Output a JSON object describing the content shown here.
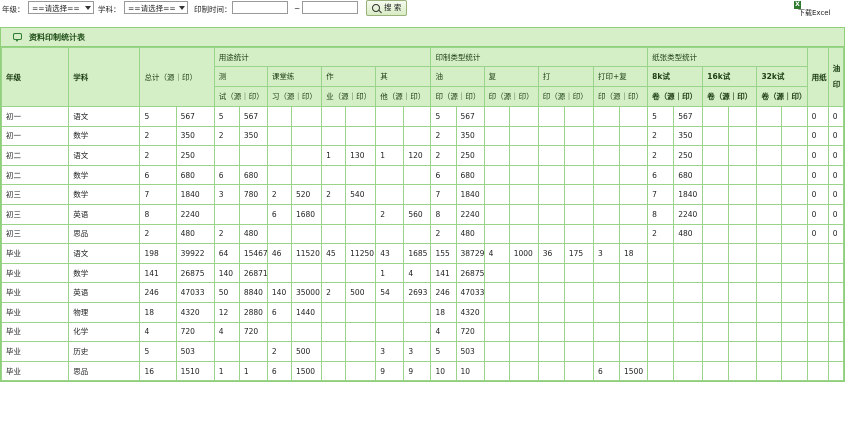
{
  "toolbar": {
    "grade_label": "年级：",
    "grade_value": "==请选择==",
    "subject_label": "学科：",
    "subject_value": "==请选择==",
    "time_label": "印制时间：",
    "time_sep": "~",
    "search_label": "搜 索",
    "excel_label": "下载Excel"
  },
  "panel": {
    "title": "资料印制统计表"
  },
  "table": {
    "h": {
      "grade": "年级",
      "subject": "学科",
      "total": "总计（源｜印）",
      "usage": "用途统计",
      "printtype": "印制类型统计",
      "paper": "纸张类型统计",
      "paperuse": "用纸",
      "oilprint": "油印",
      "test_a": "测",
      "test_b": "试（源｜印）",
      "class_a": "课堂练",
      "class_b": "习（源｜印）",
      "work_a": "作",
      "work_b": "业（源｜印）",
      "other_a": "其",
      "other_b": "他（源｜印）",
      "oil_a": "油",
      "oil_b": "印（源｜印）",
      "copy_a": "复",
      "copy_b": "印（源｜印）",
      "print_a": "打",
      "print_b": "印（源｜印）",
      "pc_a": "打印+复",
      "pc_b": "印（源｜印）",
      "p8k_a": "8k试",
      "p8k_b": "卷（源｜印）",
      "p16k_a": "16k试",
      "p16k_b": "卷（源｜印）",
      "p32k_a": "32k试",
      "p32k_b": "卷（源｜印）"
    },
    "rows": [
      [
        "初一",
        "语文",
        "5",
        "567",
        "5",
        "567",
        "",
        "",
        "",
        "",
        "",
        "",
        "5",
        "567",
        "",
        "",
        "",
        "",
        "",
        "",
        "5",
        "567",
        "",
        "",
        "",
        "",
        "0",
        "0"
      ],
      [
        "初一",
        "数学",
        "2",
        "350",
        "2",
        "350",
        "",
        "",
        "",
        "",
        "",
        "",
        "2",
        "350",
        "",
        "",
        "",
        "",
        "",
        "",
        "2",
        "350",
        "",
        "",
        "",
        "",
        "0",
        "0"
      ],
      [
        "初二",
        "语文",
        "2",
        "250",
        "",
        "",
        "",
        "",
        "1",
        "130",
        "1",
        "120",
        "2",
        "250",
        "",
        "",
        "",
        "",
        "",
        "",
        "2",
        "250",
        "",
        "",
        "",
        "",
        "0",
        "0"
      ],
      [
        "初二",
        "数学",
        "6",
        "680",
        "6",
        "680",
        "",
        "",
        "",
        "",
        "",
        "",
        "6",
        "680",
        "",
        "",
        "",
        "",
        "",
        "",
        "6",
        "680",
        "",
        "",
        "",
        "",
        "0",
        "0"
      ],
      [
        "初三",
        "数学",
        "7",
        "1840",
        "3",
        "780",
        "2",
        "520",
        "2",
        "540",
        "",
        "",
        "7",
        "1840",
        "",
        "",
        "",
        "",
        "",
        "",
        "7",
        "1840",
        "",
        "",
        "",
        "",
        "0",
        "0"
      ],
      [
        "初三",
        "英语",
        "8",
        "2240",
        "",
        "",
        "6",
        "1680",
        "",
        "",
        "2",
        "560",
        "8",
        "2240",
        "",
        "",
        "",
        "",
        "",
        "",
        "8",
        "2240",
        "",
        "",
        "",
        "",
        "0",
        "0"
      ],
      [
        "初三",
        "思品",
        "2",
        "480",
        "2",
        "480",
        "",
        "",
        "",
        "",
        "",
        "",
        "2",
        "480",
        "",
        "",
        "",
        "",
        "",
        "",
        "2",
        "480",
        "",
        "",
        "",
        "",
        "0",
        "0"
      ],
      [
        "毕业",
        "语文",
        "198",
        "39922",
        "64",
        "15467",
        "46",
        "11520",
        "45",
        "11250",
        "43",
        "1685",
        "155",
        "38729",
        "4",
        "1000",
        "36",
        "175",
        "3",
        "18",
        "",
        "",
        "",
        "",
        "",
        "",
        "",
        ""
      ],
      [
        "毕业",
        "数学",
        "141",
        "26875",
        "140",
        "26871",
        "",
        "",
        "",
        "",
        "1",
        "4",
        "141",
        "26875",
        "",
        "",
        "",
        "",
        "",
        "",
        "",
        "",
        "",
        "",
        "",
        "",
        "",
        ""
      ],
      [
        "毕业",
        "英语",
        "246",
        "47033",
        "50",
        "8840",
        "140",
        "35000",
        "2",
        "500",
        "54",
        "2693",
        "246",
        "47033",
        "",
        "",
        "",
        "",
        "",
        "",
        "",
        "",
        "",
        "",
        "",
        "",
        "",
        ""
      ],
      [
        "毕业",
        "物理",
        "18",
        "4320",
        "12",
        "2880",
        "6",
        "1440",
        "",
        "",
        "",
        "",
        "18",
        "4320",
        "",
        "",
        "",
        "",
        "",
        "",
        "",
        "",
        "",
        "",
        "",
        "",
        "",
        ""
      ],
      [
        "毕业",
        "化学",
        "4",
        "720",
        "4",
        "720",
        "",
        "",
        "",
        "",
        "",
        "",
        "4",
        "720",
        "",
        "",
        "",
        "",
        "",
        "",
        "",
        "",
        "",
        "",
        "",
        "",
        "",
        ""
      ],
      [
        "毕业",
        "历史",
        "5",
        "503",
        "",
        "",
        "2",
        "500",
        "",
        "",
        "3",
        "3",
        "5",
        "503",
        "",
        "",
        "",
        "",
        "",
        "",
        "",
        "",
        "",
        "",
        "",
        "",
        "",
        ""
      ],
      [
        "毕业",
        "思品",
        "16",
        "1510",
        "1",
        "1",
        "6",
        "1500",
        "",
        "",
        "9",
        "9",
        "10",
        "10",
        "",
        "",
        "",
        "",
        "6",
        "1500",
        "",
        "",
        "",
        "",
        "",
        "",
        "",
        ""
      ]
    ]
  }
}
